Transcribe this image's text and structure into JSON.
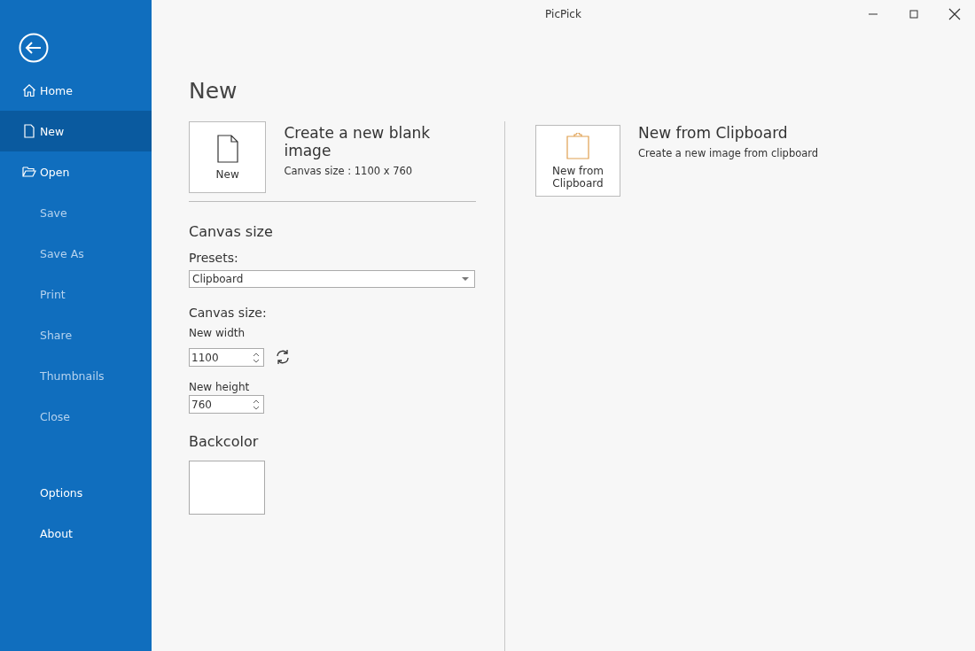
{
  "window": {
    "title": "PicPick"
  },
  "sidebar": {
    "items": [
      {
        "label": "Home",
        "kind": "home",
        "selected": false,
        "disabled": false
      },
      {
        "label": "New",
        "kind": "document",
        "selected": true,
        "disabled": false
      },
      {
        "label": "Open",
        "kind": "folder",
        "selected": false,
        "disabled": false
      },
      {
        "label": "Save",
        "kind": "plain",
        "selected": false,
        "disabled": true
      },
      {
        "label": "Save As",
        "kind": "plain",
        "selected": false,
        "disabled": true
      },
      {
        "label": "Print",
        "kind": "plain",
        "selected": false,
        "disabled": true
      },
      {
        "label": "Share",
        "kind": "plain",
        "selected": false,
        "disabled": true
      },
      {
        "label": "Thumbnails",
        "kind": "plain",
        "selected": false,
        "disabled": true
      },
      {
        "label": "Close",
        "kind": "plain",
        "selected": false,
        "disabled": true
      }
    ],
    "footer_items": [
      {
        "label": "Options",
        "selected": false,
        "disabled": false
      },
      {
        "label": "About",
        "selected": false,
        "disabled": false
      }
    ]
  },
  "page_title": "New",
  "blank": {
    "button_label": "New",
    "title": "Create a new blank image",
    "subtitle": "Canvas size : 1100 x 760"
  },
  "canvas": {
    "heading": "Canvas size",
    "presets_label": "Presets:",
    "preset_value": "Clipboard",
    "size_label": "Canvas size:",
    "width_label": "New width",
    "width_value": "1100",
    "height_label": "New height",
    "height_value": "760"
  },
  "backcolor": {
    "heading": "Backcolor"
  },
  "clipboard": {
    "button_label": "New from Clipboard",
    "title": "New from Clipboard",
    "subtitle": "Create a new image from clipboard"
  }
}
